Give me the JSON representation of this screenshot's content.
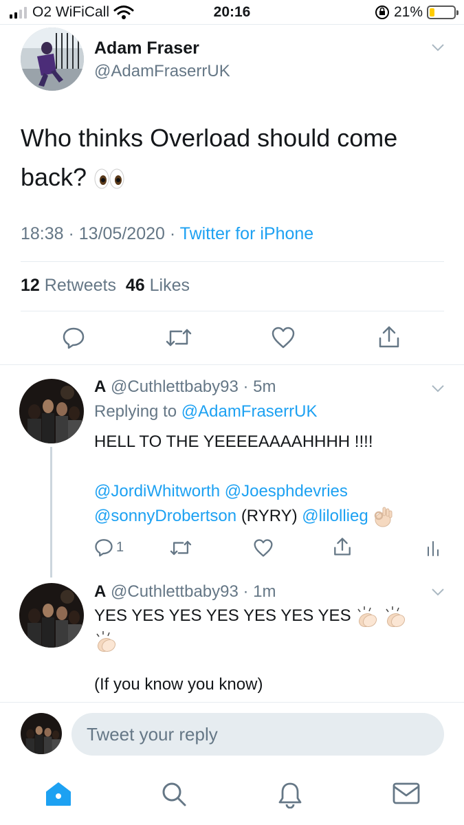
{
  "status_bar": {
    "carrier": "O2 WiFiCall",
    "time": "20:16",
    "battery_percent_label": "21%",
    "battery_level": 0.21
  },
  "main_tweet": {
    "name": "Adam Fraser",
    "handle": "@AdamFraserrUK",
    "text": "Who thinks Overload should come back?",
    "timestamp": "18:38 · 13/05/2020 · ",
    "source": "Twitter for iPhone",
    "retweets_count": "12",
    "retweets_label": "Retweets",
    "likes_count": "46",
    "likes_label": "Likes"
  },
  "replies": [
    {
      "name": "A",
      "handle": "@Cuthlettbaby93",
      "time": "· 5m",
      "replying_to_label": "Replying to",
      "replying_to": "@AdamFraserrUK",
      "text_line1": "HELL TO THE YEEEEAAAAHHHH !!!!",
      "mention1": "@JordiWhitworth",
      "mention2": "@Joesphdevries",
      "mention3": "@sonnyDrobertson",
      "text_mid": "(RYRY)",
      "mention4": "@lilollieg",
      "reply_count": "1"
    },
    {
      "name": "A",
      "handle": "@Cuthlettbaby93",
      "time": "· 1m",
      "text_line1": "YES YES YES YES YES YES YES",
      "text_line2": "(If you know you know)"
    }
  ],
  "compose": {
    "placeholder": "Tweet your reply"
  },
  "colors": {
    "accent": "#1da1f2",
    "secondary_text": "#657786",
    "divider": "#e6ecf0"
  }
}
